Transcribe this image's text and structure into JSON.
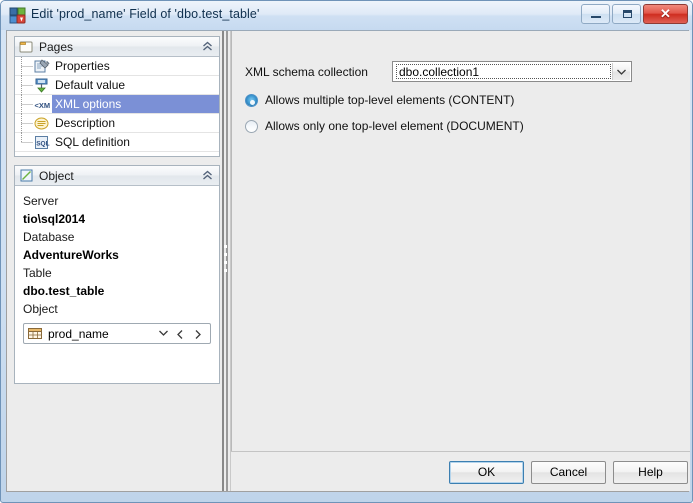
{
  "window": {
    "title": "Edit 'prod_name' Field of 'dbo.test_table'",
    "app_icon": "app-icon",
    "controls": {
      "minimize": "minimize-icon",
      "maximize": "maximize-icon",
      "close": "close-icon",
      "close_glyph": "✕"
    },
    "accent_color": "#7b90d6",
    "close_color": "#cf2d20"
  },
  "pages_panel": {
    "title": "Pages",
    "icon": "pages-folder-icon",
    "collapse_icon": "chevron-up-icon",
    "items": [
      {
        "label": "Properties",
        "icon": "properties-icon",
        "selected": false
      },
      {
        "label": "Default value",
        "icon": "default-value-icon",
        "selected": false
      },
      {
        "label": "XML options",
        "icon": "xml-icon",
        "selected": true
      },
      {
        "label": "Description",
        "icon": "description-icon",
        "selected": false
      },
      {
        "label": "SQL definition",
        "icon": "sql-definition-icon",
        "selected": false
      }
    ]
  },
  "object_panel": {
    "title": "Object",
    "icon": "object-icon",
    "collapse_icon": "chevron-up-icon",
    "fields": [
      {
        "label": "Server",
        "value": "tio\\sql2014"
      },
      {
        "label": "Database",
        "value": "AdventureWorks"
      },
      {
        "label": "Table",
        "value": "dbo.test_table"
      }
    ],
    "object_label": "Object",
    "object_combo": {
      "icon": "table-grid-icon",
      "value": "prod_name",
      "dropdown_icon": "chevron-down-icon",
      "prev_icon": "arrow-left-icon",
      "next_icon": "arrow-right-icon"
    }
  },
  "main": {
    "schema_field": {
      "label": "XML schema collection",
      "value": "dbo.collection1",
      "dropdown_icon": "chevron-down-icon"
    },
    "radios": [
      {
        "label": "Allows multiple top-level elements (CONTENT)",
        "checked": true
      },
      {
        "label": "Allows only one top-level element (DOCUMENT)",
        "checked": false
      }
    ]
  },
  "footer": {
    "ok": "OK",
    "cancel": "Cancel",
    "help": "Help"
  }
}
